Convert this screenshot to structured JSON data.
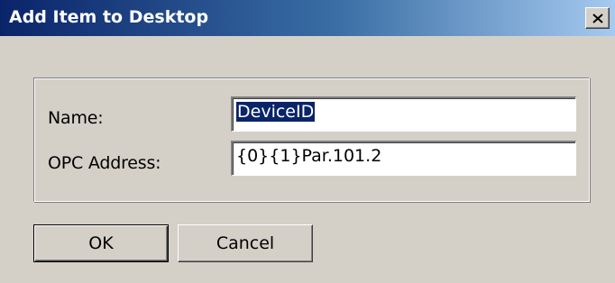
{
  "window": {
    "title": "Add Item to Desktop",
    "close_icon": "close-x-icon"
  },
  "form": {
    "name_label": "Name:",
    "name_value": "DeviceID",
    "opc_label": "OPC Address:",
    "opc_value": "{0}{1}Par.101.2"
  },
  "buttons": {
    "ok_label": "OK",
    "cancel_label": "Cancel"
  },
  "colors": {
    "face": "#d4d0c8",
    "title_start": "#0a246a",
    "title_end": "#a6caf0",
    "selection": "#0a246a"
  }
}
